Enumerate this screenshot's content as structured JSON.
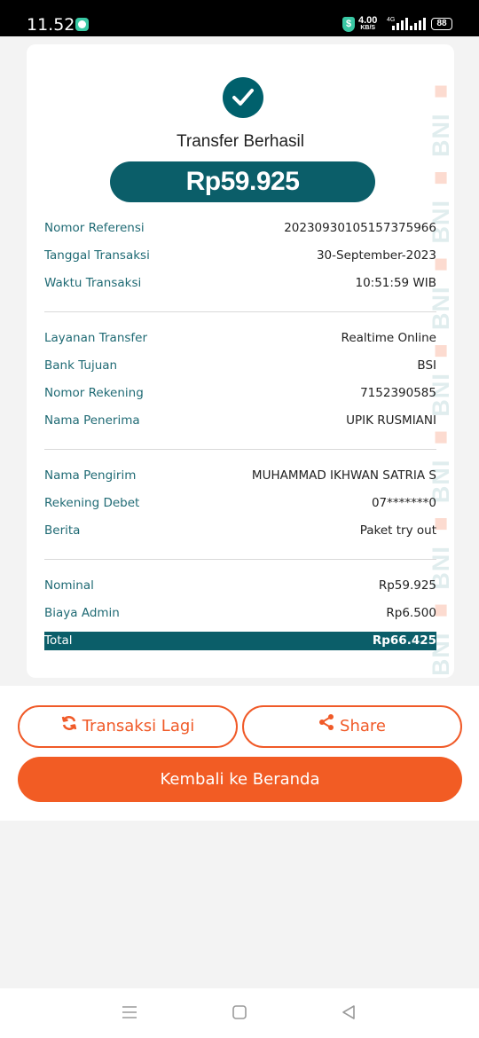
{
  "status_bar": {
    "time": "11.52",
    "net_speed": "4.00",
    "net_unit": "KB/S",
    "network_type": "4G",
    "battery": "88"
  },
  "receipt": {
    "title": "Transfer Berhasil",
    "amount": "Rp59.925",
    "watermark": "BNI",
    "sections": [
      [
        {
          "label": "Nomor Referensi",
          "value": "20230930105157375966"
        },
        {
          "label": "Tanggal Transaksi",
          "value": "30-September-2023"
        },
        {
          "label": "Waktu Transaksi",
          "value": "10:51:59 WIB"
        }
      ],
      [
        {
          "label": "Layanan Transfer",
          "value": "Realtime Online"
        },
        {
          "label": "Bank Tujuan",
          "value": "BSI"
        },
        {
          "label": "Nomor Rekening",
          "value": "7152390585"
        },
        {
          "label": "Nama Penerima",
          "value": "UPIK RUSMIANI"
        }
      ],
      [
        {
          "label": "Nama Pengirim",
          "value": "MUHAMMAD IKHWAN SATRIA S"
        },
        {
          "label": "Rekening Debet",
          "value": "07*******0"
        },
        {
          "label": "Berita",
          "value": "Paket try out"
        }
      ],
      [
        {
          "label": "Nominal",
          "value": "Rp59.925"
        },
        {
          "label": "Biaya Admin",
          "value": "Rp6.500"
        }
      ]
    ],
    "total": {
      "label": "Total",
      "value": "Rp66.425"
    }
  },
  "actions": {
    "repeat_label": "Transaksi Lagi",
    "repeat_icon": "refresh-icon",
    "share_label": "Share",
    "share_icon": "share-icon",
    "home_label": "Kembali ke Beranda"
  },
  "colors": {
    "primary_teal": "#0b5e69",
    "accent_orange": "#f25c24"
  }
}
